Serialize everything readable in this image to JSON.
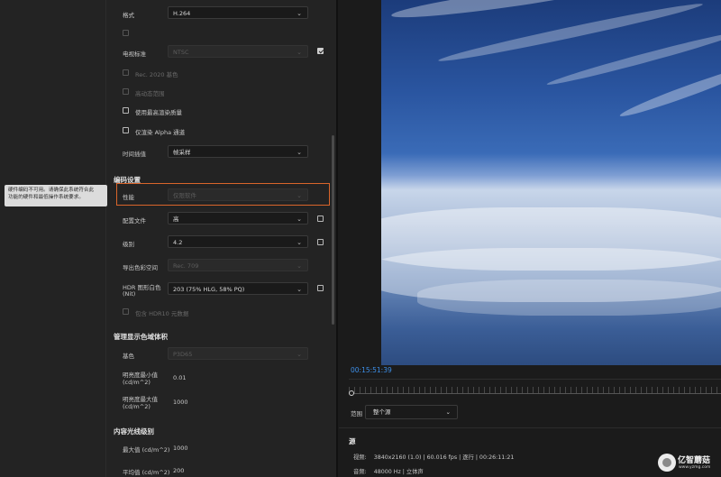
{
  "video_settings": {
    "format": {
      "label": "格式",
      "value": "H.264"
    },
    "tv_standard": {
      "label": "电视标准",
      "value": "NTSC"
    },
    "rec2020": {
      "label": "Rec. 2020 基色"
    },
    "hdr_graphics": {
      "label": "高动态范围"
    },
    "max_render_quality": {
      "label": "使用最高渲染质量"
    },
    "alpha_only": {
      "label": "仅渲染 Alpha 通道"
    },
    "time_interpolation": {
      "label": "时间插值",
      "value": "帧采样"
    }
  },
  "encoding": {
    "section_title": "编码设置",
    "performance": {
      "label": "性能",
      "value": "仅限软件"
    },
    "profile": {
      "label": "配置文件",
      "value": "高"
    },
    "level": {
      "label": "级别",
      "value": "4.2"
    },
    "export_color_space": {
      "label": "导出色彩空间",
      "value": "Rec. 709"
    },
    "hdr_graphics_white": {
      "label_line1": "HDR 图形白色",
      "label_line2": "(Nit)",
      "value": "203 (75% HLG, 58% PQ)"
    },
    "include_hdr10": {
      "label": "包含 HDR10 元数据"
    }
  },
  "tooltip": {
    "line1": "硬件编码不可用。请确保此系统符合此",
    "line2": "功能的硬件和最低操作系统要求。"
  },
  "mastering_display": {
    "section_title": "管理显示色域体积",
    "primaries": {
      "label": "基色",
      "value": "P3D65"
    },
    "min_luminance": {
      "label_line1": "明亮度最小值",
      "label_line2": "(cd/m^2)",
      "value": "0.01"
    },
    "max_luminance": {
      "label_line1": "明亮度最大值",
      "label_line2": "(cd/m^2)",
      "value": "1000"
    }
  },
  "content_light": {
    "section_title": "内容光线级别",
    "max_value": {
      "label": "最大值 (cd/m^2)",
      "value": "1000"
    },
    "avg_value": {
      "label": "平均值 (cd/m^2)",
      "value": "200"
    }
  },
  "preview": {
    "timecode": "00:15:51:39",
    "range_label": "范围",
    "range_value": "整个源"
  },
  "source": {
    "title": "源",
    "video_label": "视频:",
    "video_value": "3840x2160 (1.0) | 60.016 fps | 逐行 | 00:26:11:21",
    "audio_label": "音频:",
    "audio_value": "48000 Hz | 立体声"
  },
  "watermark": {
    "text": "亿智蘑菇",
    "sub": "www.yzmg.com"
  },
  "colors": {
    "accent_blue": "#3d8fe8",
    "highlight_orange": "#d9652b"
  }
}
